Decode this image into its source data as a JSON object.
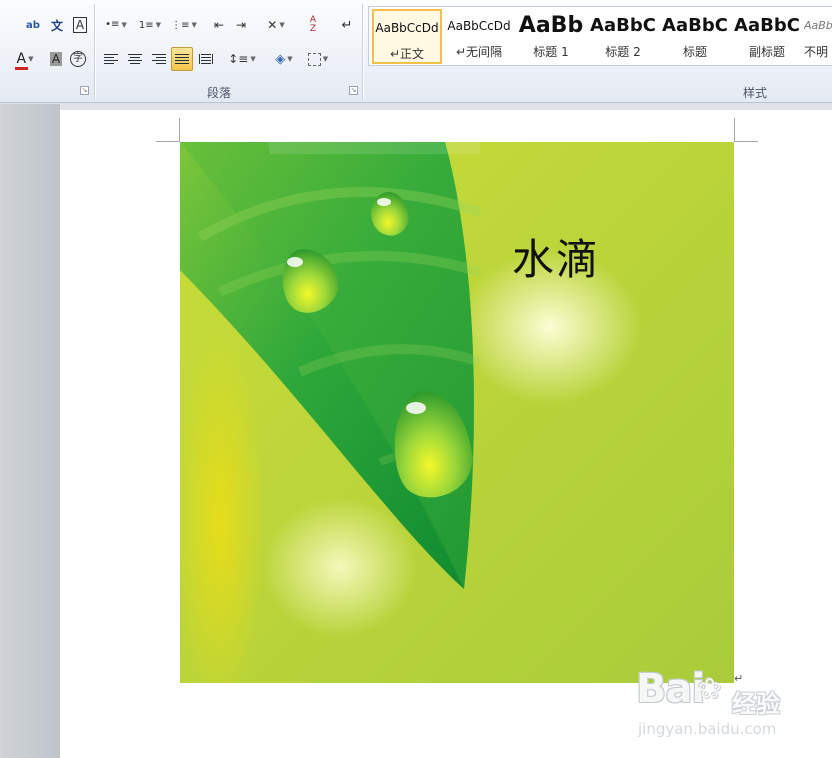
{
  "ribbon": {
    "paragraph_group_label": "段落",
    "styles_group_label": "样式",
    "launcher_glyph": "↘",
    "font_tools": {
      "phonetic": "ab",
      "char_border": "A",
      "font_color": "A",
      "char_shading": "A",
      "enclose_char": "字",
      "font_color_accent": "#d42020"
    },
    "styles": [
      {
        "sample": "AaBbCcDd",
        "name": "↵正文",
        "selected": true
      },
      {
        "sample": "AaBbCcDd",
        "name": "↵无间隔",
        "selected": false
      },
      {
        "sample": "AaBb",
        "name": "标题 1",
        "selected": false
      },
      {
        "sample": "AaBbC",
        "name": "标题 2",
        "selected": false
      },
      {
        "sample": "AaBbC",
        "name": "标题",
        "selected": false
      },
      {
        "sample": "AaBbC",
        "name": "副标题",
        "selected": false
      },
      {
        "sample": "AaBb",
        "name": "不明",
        "selected": false
      }
    ]
  },
  "document": {
    "picture_title": "水滴",
    "paragraph_mark": "↵"
  },
  "watermark": {
    "brand": "Bai",
    "brand_cn": "经验",
    "url": "jingyan.baidu.com"
  }
}
